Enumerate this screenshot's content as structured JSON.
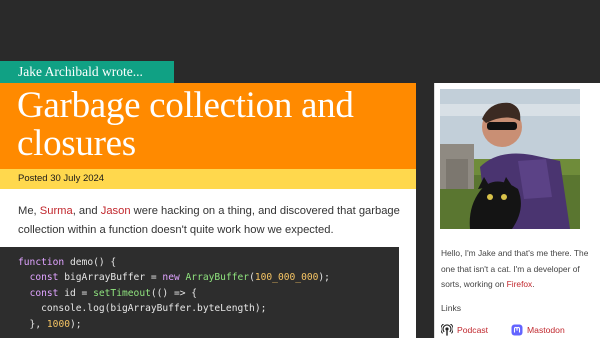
{
  "post": {
    "byline": "Jake Archibald wrote...",
    "title": "Garbage collection and closures",
    "posted": "Posted 30 July 2024",
    "intro": {
      "before": "Me, ",
      "link1": "Surma",
      "between": ", and ",
      "link2": "Jason",
      "after": " were hacking on a thing, and discovered that garbage collection within a function doesn't quite work how we expected."
    }
  },
  "code": {
    "line1": {
      "kw": "function",
      "rest": " demo() {"
    },
    "line2": {
      "indent": "  ",
      "kw": "const",
      "mid": " bigArrayBuffer = ",
      "kw2": "new",
      "sp": " ",
      "fn": "ArrayBuffer",
      "open": "(",
      "num": "100_000_000",
      "close": ");"
    },
    "line3": {
      "indent": "  ",
      "kw": "const",
      "mid": " id = ",
      "fn": "setTimeout",
      "rest": "(() => {"
    },
    "line4": {
      "text": "    console.log(bigArrayBuffer.byteLength);"
    },
    "line5": {
      "start": "  }, ",
      "num": "1000",
      "end": ");"
    }
  },
  "sidebar": {
    "avatar_alt": "Photo of Jake with a black cat",
    "bio_before": "Hello, I'm Jake and that's me there. The one that isn't a cat. I'm a developer of sorts, working on ",
    "bio_link": "Firefox",
    "bio_after": ".",
    "links_heading": "Links",
    "links": [
      {
        "label": "Podcast",
        "icon": "podcast-icon"
      },
      {
        "label": "Mastodon",
        "icon": "mastodon-icon"
      }
    ]
  },
  "colors": {
    "byline_bg": "#10a184",
    "title_bg": "#ff8a00",
    "posted_bg": "#ffd84d",
    "link": "#c1272d",
    "code_bg": "#2d2d2d"
  }
}
